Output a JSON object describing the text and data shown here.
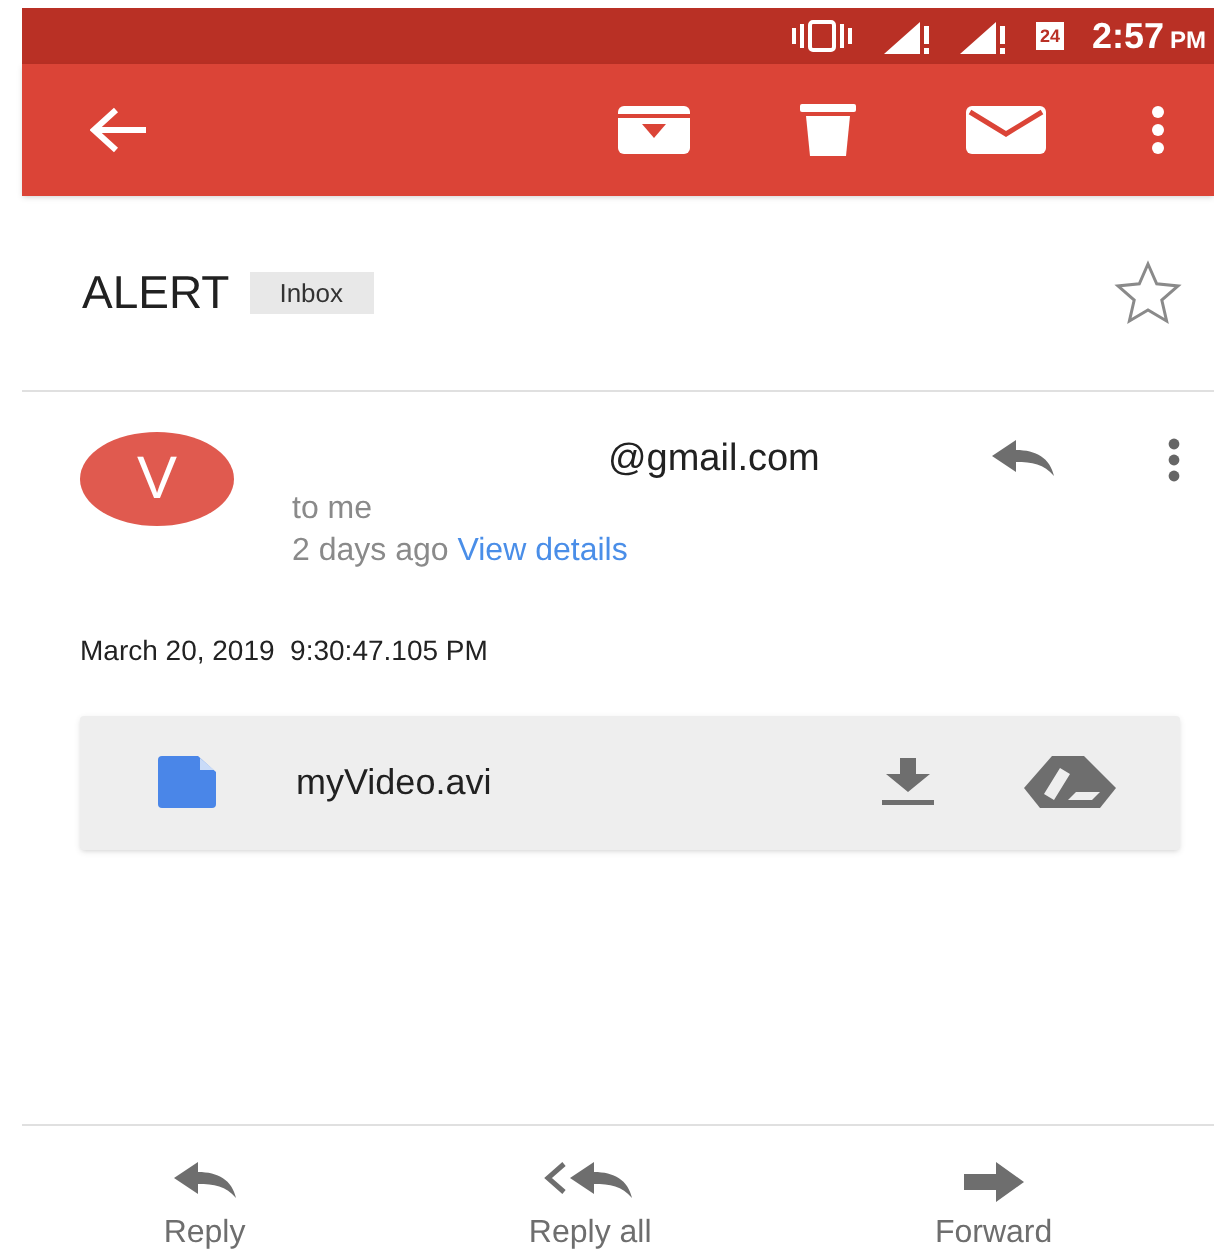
{
  "status_bar": {
    "calendar_day": "24",
    "time": "2:57",
    "time_suffix": "PM"
  },
  "message": {
    "subject": "ALERT",
    "label": "Inbox",
    "starred": false,
    "sender": {
      "initial": "V",
      "address": "@gmail.com",
      "recipient": "to me",
      "age": "2 days ago",
      "details_link": "View details"
    },
    "body": "March 20, 2019  9:30:47.105 PM",
    "attachment": {
      "filename": "myVideo.avi"
    }
  },
  "actions": [
    {
      "kind": "reply",
      "label": "Reply"
    },
    {
      "kind": "reply_all",
      "label": "Reply all"
    },
    {
      "kind": "forward",
      "label": "Forward"
    }
  ]
}
